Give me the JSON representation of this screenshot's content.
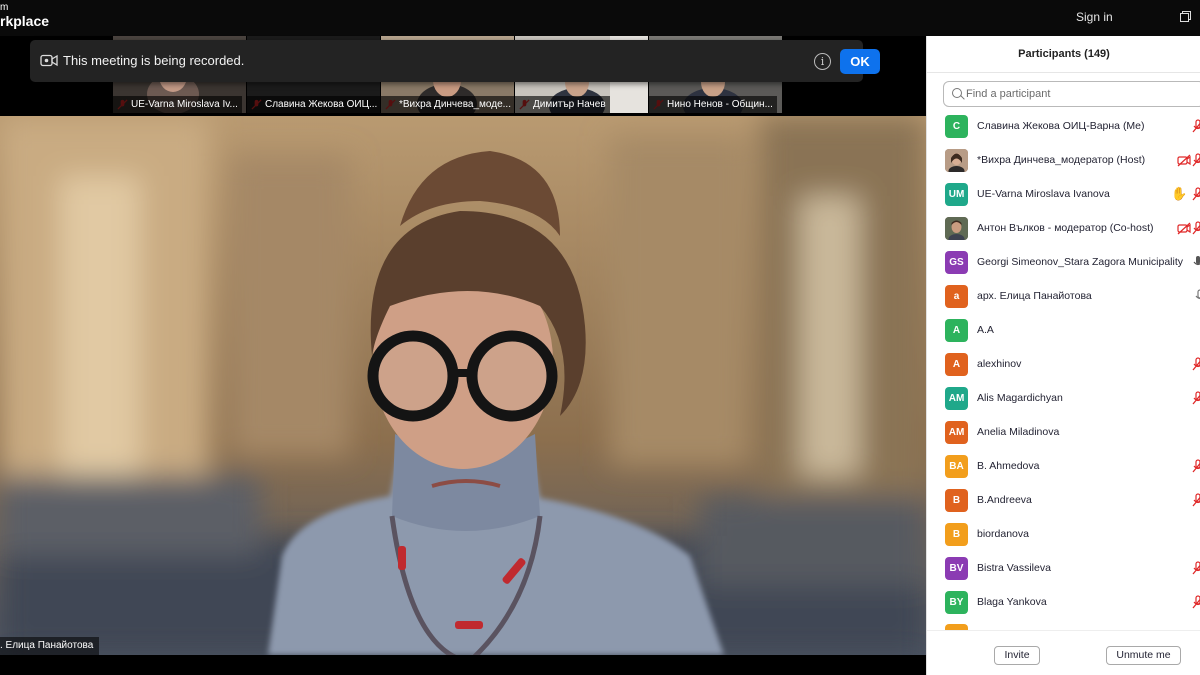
{
  "titlebar": {
    "logo_top": "m",
    "logo_main": "rkplace",
    "signin_label": "Sign in",
    "restore_icon": "restore-window-icon"
  },
  "banner": {
    "text": "This meeting is being recorded.",
    "ok_label": "OK",
    "icon": "video-record-icon",
    "info_icon": "info-icon"
  },
  "thumbnails": [
    {
      "name": "UE-Varna Miroslava Iv..."
    },
    {
      "name": "Славина Жекова ОИЦ..."
    },
    {
      "name": "*Вихра Динчева_моде..."
    },
    {
      "name": "Димитър Начев"
    },
    {
      "name": "Нино Ненов - Общин..."
    }
  ],
  "main_video": {
    "speaker_name": ". Елица Панайотова"
  },
  "participants_panel": {
    "title": "Participants (149)",
    "search_placeholder": "Find a participant",
    "rows": [
      {
        "name": "Славина Жекова ОИЦ-Варна (Me)",
        "initials": "С",
        "color": "#2db35d",
        "status": "mic-muted-icon"
      },
      {
        "name": "*Вихра Динчева_модератор (Host)",
        "initials": "",
        "color": "#9a7a62",
        "status": "mic-muted-icon",
        "extra": "video-off-icon"
      },
      {
        "name": "UE-Varna Miroslava Ivanova",
        "initials": "UM",
        "color": "#1fa88a",
        "status": "mic-muted-icon",
        "extra": "raise-hand-icon"
      },
      {
        "name": "Антон Вълков - модератор (Co-host)",
        "initials": "",
        "color": "#6b5a48",
        "status": "mic-muted-icon",
        "extra": "video-off-icon"
      },
      {
        "name": "Georgi Simeonov_Stara Zagora Municipality",
        "initials": "GS",
        "color": "#8b3bb3",
        "status": "mic-active-icon"
      },
      {
        "name": "арх. Елица Панайотова",
        "initials": "a",
        "color": "#e0621e",
        "status": "mic-on-icon"
      },
      {
        "name": "A.A",
        "initials": "A",
        "color": "#2db35d",
        "status": ""
      },
      {
        "name": "alexhinov",
        "initials": "A",
        "color": "#e0621e",
        "status": "mic-muted-icon"
      },
      {
        "name": "Alis Magardichyan",
        "initials": "AM",
        "color": "#1fa88a",
        "status": "mic-muted-icon"
      },
      {
        "name": "Anelia Miladinova",
        "initials": "AM",
        "color": "#e0621e",
        "status": ""
      },
      {
        "name": "B. Ahmedova",
        "initials": "BA",
        "color": "#f29e1c",
        "status": "mic-muted-icon"
      },
      {
        "name": "B.Andreeva",
        "initials": "B",
        "color": "#e0621e",
        "status": "mic-muted-icon"
      },
      {
        "name": "biordanova",
        "initials": "B",
        "color": "#f29e1c",
        "status": ""
      },
      {
        "name": "Bistra Vassileva",
        "initials": "BV",
        "color": "#8b3bb3",
        "status": "mic-muted-icon"
      },
      {
        "name": "Blaga Yankova",
        "initials": "BY",
        "color": "#2db35d",
        "status": "mic-muted-icon"
      }
    ],
    "invite_label": "Invite",
    "unmute_label": "Unmute me"
  },
  "colors": {
    "accent": "#0e72ed",
    "muted_red": "#e02828"
  }
}
